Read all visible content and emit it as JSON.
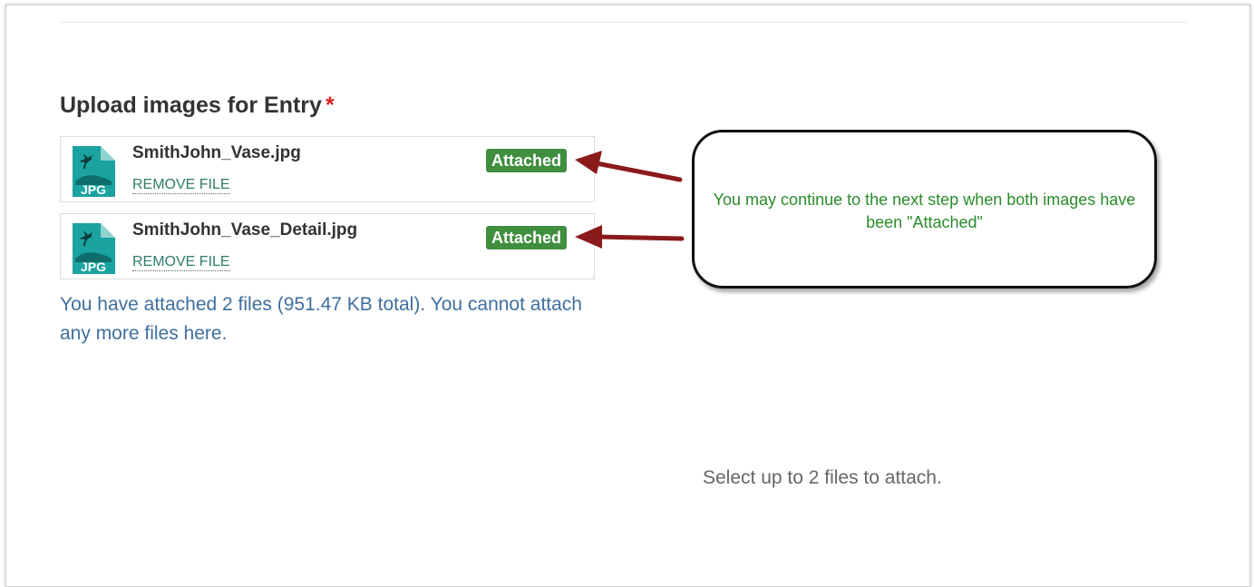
{
  "upload": {
    "title": "Upload images for Entry",
    "required_marker": "*",
    "files": [
      {
        "name": "SmithJohn_Vase.jpg",
        "icon_label": "JPG",
        "remove_label": "REMOVE FILE",
        "status": "Attached"
      },
      {
        "name": "SmithJohn_Vase_Detail.jpg",
        "icon_label": "JPG",
        "remove_label": "REMOVE FILE",
        "status": "Attached"
      }
    ],
    "summary": "You have attached 2 files (951.47 KB total). You cannot attach any more files here.",
    "select_hint": "Select up to 2 files to attach."
  },
  "callout": {
    "text": "You may continue to the next step when both images have been \"Attached\""
  },
  "icons": {
    "file_icon": "jpg-file-icon",
    "arrow": "arrow-left-icon"
  },
  "colors": {
    "badge": "#3f8f3f",
    "link": "#2e7d6b",
    "summary": "#3f6f9e",
    "callout_text": "#2a8c2a",
    "arrow": "#8b1a1a",
    "required": "#e02020",
    "icon": "#1aa3a0"
  }
}
